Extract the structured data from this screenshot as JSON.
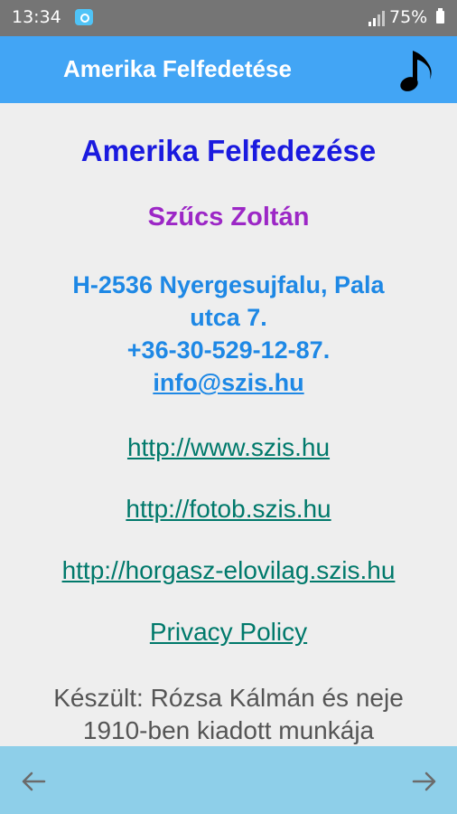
{
  "status_bar": {
    "time": "13:34",
    "battery": "75%"
  },
  "app_bar": {
    "title": "Amerika Felfedetése",
    "music_icon": "music-note-icon"
  },
  "content": {
    "title": "Amerika Felfedezése",
    "author": "Szűcs Zoltán",
    "address_line1": "H-2536 Nyergesujfalu, Pala",
    "address_line2": "utca 7.",
    "phone": "+36-30-529-12-87.",
    "email": "info@szis.hu",
    "links": [
      "http://www.szis.hu",
      "http://fotob.szis.hu",
      "http://horgasz-elovilag.szis.hu",
      "Privacy Policy"
    ],
    "credit_line1": "Készült: Rózsa Kálmán és neje",
    "credit_line2": "1910-ben kiadott munkája"
  },
  "bottom_bar": {
    "back_icon": "arrow-left-icon",
    "forward_icon": "arrow-right-icon"
  },
  "colors": {
    "app_bar": "#42a5f5",
    "bottom_bar": "#8ecfe9",
    "title": "#1a1adf",
    "author": "#9c27c6",
    "address": "#1e88e5",
    "link": "#00796b"
  }
}
